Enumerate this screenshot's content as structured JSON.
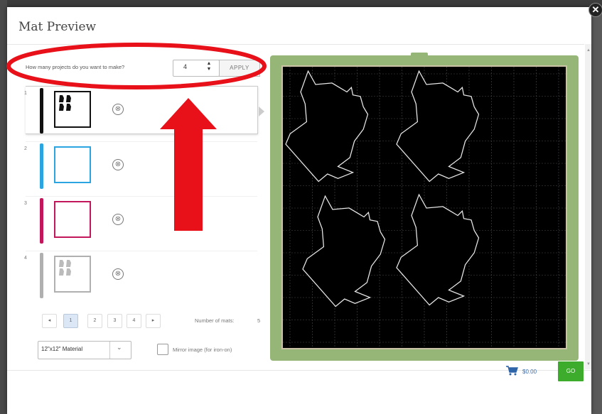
{
  "dialog": {
    "title": "Mat Preview",
    "close_symbol": "✕"
  },
  "quantity": {
    "label": "How many projects do you want to make?",
    "value": "4",
    "stepper_glyph": "▲▼",
    "apply_label": "APPLY"
  },
  "mats": [
    {
      "number": "1",
      "color": "#111111",
      "active": true
    },
    {
      "number": "2",
      "color": "#2aa5e1",
      "active": false
    },
    {
      "number": "3",
      "color": "#c2185b",
      "active": false
    },
    {
      "number": "4",
      "color": "#b0b0b0",
      "active": false
    }
  ],
  "cut_icon_symbol": "⊗",
  "pagination": {
    "prev": "◂",
    "pages": [
      "1",
      "2",
      "3",
      "4"
    ],
    "current": "1",
    "next": "▸"
  },
  "mats_count": {
    "label": "Number of mats:",
    "value": "5"
  },
  "material": {
    "value": "12\"x12\" Material",
    "caret": "⌄"
  },
  "mirror": {
    "label": "Mirror image (for iron-on)",
    "checked": false
  },
  "footer": {
    "price": "$0.00",
    "go_label": "GO"
  },
  "colors": {
    "accent_green": "#3dab2b",
    "mat_green": "#96b678",
    "annotation_red": "#e8111a"
  }
}
